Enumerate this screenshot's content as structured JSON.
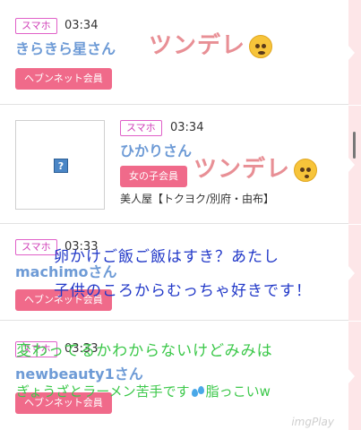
{
  "posts": [
    {
      "tag": "スマホ",
      "time": "03:34",
      "name": "きらきら星さん",
      "badge": "ヘブンネット会員",
      "sticker": "ツンデレ"
    },
    {
      "tag": "スマホ",
      "time": "03:34",
      "name": "ひかりさん",
      "badge": "女の子会員",
      "shop": "美人屋【トクヨク/別府・由布】",
      "thumb_glyph": "?",
      "sticker": "ツンデレ"
    },
    {
      "tag": "スマホ",
      "time": "03:33",
      "name": "machimoさん",
      "badge": "ヘブンネット会員"
    },
    {
      "tag": "スマホ",
      "time": "03:33",
      "name": "newbeauty1さん",
      "badge": "ヘブンネット会員"
    }
  ],
  "overlay_text": {
    "line1": "卵かけご飯ご飯はすき？あたし",
    "line2": "子供のころからむっちゃ好きです！",
    "line3": "変わってるかわからないけどみみは",
    "line4a": "ぎょうざとラーメン苦手です",
    "line4b": "脂っこいw"
  },
  "watermark": "imgPlay",
  "icons": {
    "emoji1": "flushed-face-icon",
    "emoji2": "kissing-face-icon",
    "sweat": "sweat-droplets-icon",
    "thumb": "missing-image-icon"
  },
  "colors": {
    "accent_pink": "#f06a8a",
    "tag_magenta": "#d040b8",
    "name_blue": "#6e9bd6",
    "rail_pink": "#fde6e8"
  }
}
